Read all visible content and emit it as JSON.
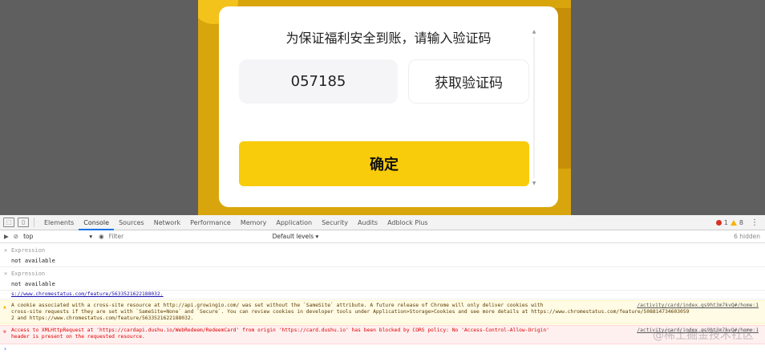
{
  "modal": {
    "title": "为保证福利安全到账，请输入验证码",
    "code_value": "057185",
    "get_code_label": "获取验证码",
    "confirm_label": "确定"
  },
  "devtools": {
    "tabs": [
      "Elements",
      "Console",
      "Sources",
      "Network",
      "Performance",
      "Memory",
      "Application",
      "Security",
      "Audits",
      "Adblock Plus"
    ],
    "active_tab": "Console",
    "error_count": "1",
    "warning_count": "8",
    "context": "top",
    "filter_placeholder": "Filter",
    "levels": "Default levels ▾",
    "hidden_count": "6 hidden",
    "expressions": [
      {
        "label": "Expression",
        "value": "not available"
      },
      {
        "label": "Expression",
        "value": "not available"
      }
    ],
    "logs": {
      "link_line": "s://www.chromestatus.com/feature/5633521622188032.",
      "warning": {
        "line1": "A cookie associated with a cross-site resource at http://api.growingio.com/ was set without the `SameSite` attribute. A future release of Chrome will only deliver cookies with",
        "line2": "cross-site requests if they are set with `SameSite=None` and `Secure`. You can review cookies in developer tools under Application>Storage>Cookies and see more details at https://www.chromestatus.com/feature/508814734603059",
        "line3": "2 and https://www.chromestatus.com/feature/5633521622188032.",
        "source": "/activity/card/index.gs9ht3m7kvQ#/home:1"
      },
      "error": {
        "line1": "Access to XMLHttpRequest at 'https://cardapi.dushu.io/WebRedeem/RedeemCard' from origin 'https://card.dushu.io' has been blocked by CORS policy: No 'Access-Control-Allow-Origin'",
        "line2": "header is present on the requested resource.",
        "source": "/activity/card/index.gs9ht3m7kvQ#/home:1"
      }
    },
    "prompt": "›"
  },
  "watermark": "@稀土掘金技术社区",
  "colors": {
    "accent_yellow": "#f9cc0b",
    "overlay": "#5f5f5f",
    "devtools_blue": "#1a73e8",
    "error_red": "#d93025",
    "warning_yellow": "#f4b400"
  }
}
